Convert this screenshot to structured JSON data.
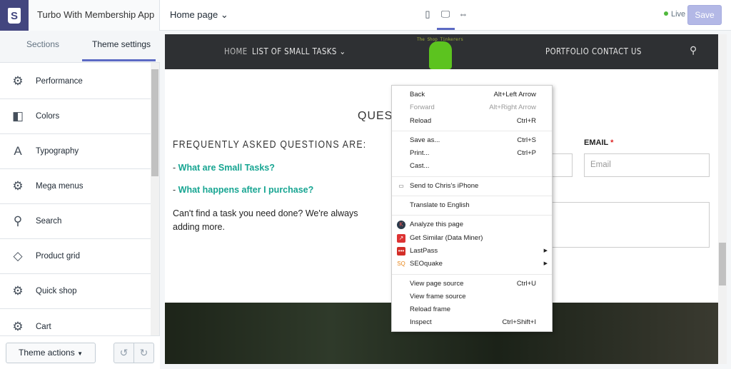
{
  "app": {
    "title": "Turbo With Membership App",
    "page_selector": "Home page",
    "live_label": "Live",
    "save_label": "Save",
    "accent": "#5c6ac4",
    "live_color": "#50b83c"
  },
  "devices": [
    {
      "icon": "mobile-icon"
    },
    {
      "icon": "desktop-icon",
      "active": true
    },
    {
      "icon": "fullscreen-icon"
    }
  ],
  "sidebar": {
    "tabs": [
      {
        "label": "Sections"
      },
      {
        "label": "Theme settings",
        "active": true
      }
    ],
    "items": [
      {
        "label": "Performance",
        "icon": "gear-icon"
      },
      {
        "label": "Colors",
        "icon": "paint-icon"
      },
      {
        "label": "Typography",
        "icon": "type-icon"
      },
      {
        "label": "Mega menus",
        "icon": "gear-icon"
      },
      {
        "label": "Search",
        "icon": "search-icon"
      },
      {
        "label": "Product grid",
        "icon": "tag-icon"
      },
      {
        "label": "Quick shop",
        "icon": "gear-icon"
      },
      {
        "label": "Cart",
        "icon": "gear-icon"
      }
    ],
    "theme_actions": "Theme actions"
  },
  "preview": {
    "shop_name": "The Shop Tinkerers",
    "nav": {
      "home": "HOME",
      "tasks": "LIST OF SMALL TASKS",
      "portfolio": "PORTFOLIO",
      "contact": "CONTACT US"
    },
    "section_title": "QUEST",
    "faq_heading": "FREQUENTLY ASKED QUESTIONS ARE:",
    "faq_dash": "- ",
    "faq": [
      "What are Small Tasks?",
      "What happens after I purchase?"
    ],
    "cant_find": "Can't find a task you need done? We're always adding more.",
    "email_label": "EMAIL",
    "required": "*",
    "email_placeholder": "Email",
    "link_color": "#17a592"
  },
  "context_menu": {
    "groups": [
      [
        {
          "label": "Back",
          "shortcut": "Alt+Left Arrow"
        },
        {
          "label": "Forward",
          "shortcut": "Alt+Right Arrow",
          "disabled": true
        },
        {
          "label": "Reload",
          "shortcut": "Ctrl+R"
        }
      ],
      [
        {
          "label": "Save as...",
          "shortcut": "Ctrl+S"
        },
        {
          "label": "Print...",
          "shortcut": "Ctrl+P"
        },
        {
          "label": "Cast..."
        }
      ],
      [
        {
          "label": "Send to Chris's iPhone",
          "icon": "devices-icon"
        }
      ],
      [
        {
          "label": "Translate to English"
        }
      ],
      [
        {
          "label": "Analyze this page",
          "icon": "k-icon"
        },
        {
          "label": "Get Similar (Data Miner)",
          "icon": "data-miner-icon"
        },
        {
          "label": "LastPass",
          "icon": "lastpass-icon",
          "submenu": true
        },
        {
          "label": "SEOquake",
          "icon": "seoquake-icon",
          "submenu": true
        }
      ],
      [
        {
          "label": "View page source",
          "shortcut": "Ctrl+U"
        },
        {
          "label": "View frame source"
        },
        {
          "label": "Reload frame"
        },
        {
          "label": "Inspect",
          "shortcut": "Ctrl+Shift+I"
        }
      ]
    ]
  }
}
